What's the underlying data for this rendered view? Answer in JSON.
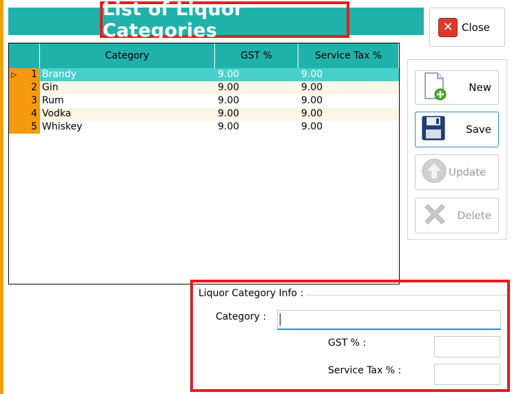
{
  "window": {
    "title": "List of Liquor Categories",
    "close_label": "Close"
  },
  "actions": {
    "new_label": "New",
    "save_label": "Save",
    "update_label": "Update",
    "delete_label": "Delete"
  },
  "grid": {
    "columns": [
      "Category",
      "GST %",
      "Service Tax %"
    ],
    "rows": [
      {
        "num": "1",
        "category": "Brandy",
        "gst": "9.00",
        "service_tax": "9.00"
      },
      {
        "num": "2",
        "category": "Gin",
        "gst": "9.00",
        "service_tax": "9.00"
      },
      {
        "num": "3",
        "category": "Rum",
        "gst": "9.00",
        "service_tax": "9.00"
      },
      {
        "num": "4",
        "category": "Vodka",
        "gst": "9.00",
        "service_tax": "9.00"
      },
      {
        "num": "5",
        "category": "Whiskey",
        "gst": "9.00",
        "service_tax": "9.00"
      }
    ],
    "selected_row": 0
  },
  "info": {
    "legend": "Liquor Category Info :",
    "category_label": "Category :",
    "category_value": "",
    "gst_label": "GST % :",
    "gst_value": "",
    "service_tax_label": "Service Tax % :",
    "service_tax_value": ""
  },
  "colors": {
    "accent_teal": "#20b2aa",
    "selected_row": "#48d1cc",
    "row_header_orange": "#f59a0f",
    "highlight_red": "#e01e1e",
    "focus_blue": "#2c86d6"
  },
  "icons": {
    "close": "close-x-icon",
    "new": "new-document-icon",
    "save": "floppy-disk-icon",
    "update": "up-arrow-icon",
    "delete": "delete-x-icon",
    "row_selector": "row-selector-triangle-icon"
  }
}
